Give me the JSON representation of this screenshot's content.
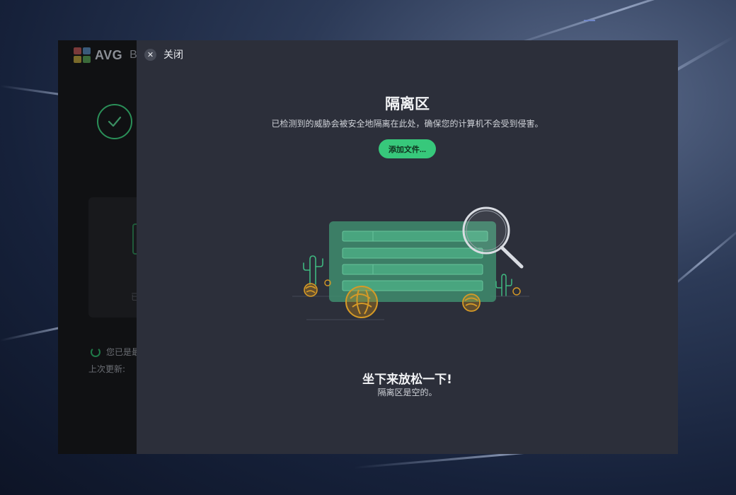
{
  "background_app": {
    "brand": "AVG",
    "product_fragment": "Bus",
    "status_text": "您已是最",
    "last_update_label": "上次更新:",
    "card_text": "已"
  },
  "overlay": {
    "close_label": "关闭",
    "title": "隔离区",
    "subtitle": "已检测到的威胁会被安全地隔离在此处，确保您的计算机不会受到侵害。",
    "add_button_label": "添加文件...",
    "empty_title": "坐下来放松一下!",
    "empty_subtitle": "隔离区是空的。"
  },
  "icons": {
    "close": "close-icon",
    "check": "check-icon",
    "magnifier": "magnifier-icon",
    "logo": "avg-logo-icon"
  },
  "colors": {
    "accent_green": "#37c87b",
    "panel_bg": "#2c2f3a",
    "tumbleweed": "#d69a26"
  }
}
